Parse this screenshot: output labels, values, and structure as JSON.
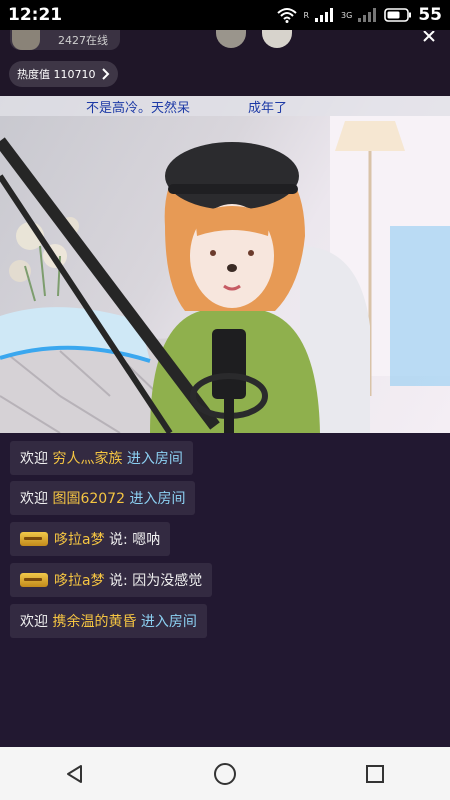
{
  "status_bar": {
    "time": "12:21",
    "network_label": "R",
    "network_type": "3G",
    "battery": "55"
  },
  "room": {
    "viewer_count": "2427在线",
    "heat_label": "热度值 110710"
  },
  "video": {
    "caption_left": "不是高冷。天然呆",
    "caption_right": "成年了"
  },
  "chat": [
    {
      "prefix": "欢迎",
      "user": "穷人灬家族",
      "suffix": "进入房间",
      "badge": false
    },
    {
      "prefix": "欢迎",
      "user": "图圄62072",
      "suffix": "进入房间",
      "badge": false
    },
    {
      "prefix": "",
      "user": "哆拉a梦",
      "suffix": "说: 嗯呐",
      "badge": true
    },
    {
      "prefix": "",
      "user": "哆拉a梦",
      "suffix": "说: 因为没感觉",
      "badge": true
    },
    {
      "prefix": "欢迎",
      "user": "携余温的黄昏",
      "suffix": "进入房间",
      "badge": false
    }
  ],
  "icons": {
    "wifi": "wifi-icon",
    "signal": "signal-icon",
    "battery": "battery-icon",
    "back": "back-triangle-icon",
    "home": "home-circle-icon",
    "recents": "recents-square-icon"
  },
  "colors": {
    "chat_bg": "#221831",
    "username": "#f5c542",
    "enter_room": "#8cd0f2",
    "caption": "#1d3aa6"
  }
}
